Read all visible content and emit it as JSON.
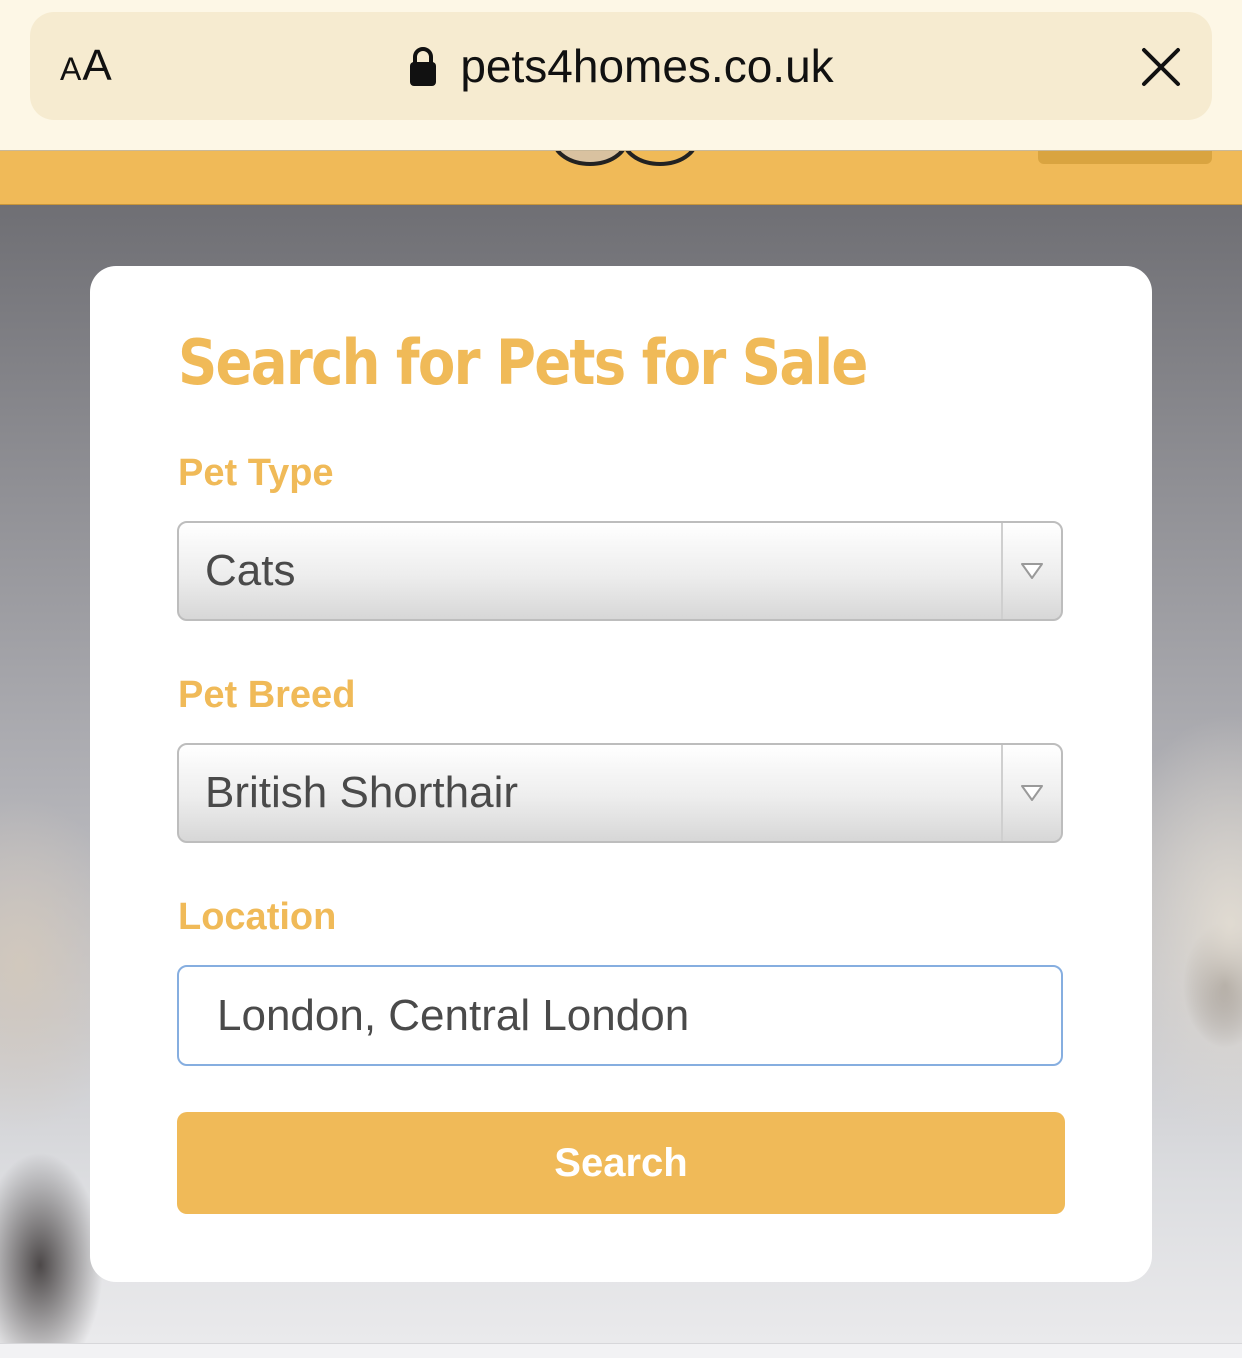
{
  "browser": {
    "text_size_label_small": "A",
    "text_size_label_large": "A",
    "url": "pets4homes.co.uk",
    "icons": {
      "lock": "lock-icon",
      "close": "close-icon"
    }
  },
  "colors": {
    "brand_yellow": "#f0ba58",
    "input_focus_border": "#86aee0",
    "text_gray": "#4a4a4a"
  },
  "search_form": {
    "title": "Search for Pets for Sale",
    "pet_type": {
      "label": "Pet Type",
      "selected": "Cats"
    },
    "pet_breed": {
      "label": "Pet Breed",
      "selected": "British Shorthair"
    },
    "location": {
      "label": "Location",
      "value": "London, Central London"
    },
    "search_button_label": "Search"
  }
}
